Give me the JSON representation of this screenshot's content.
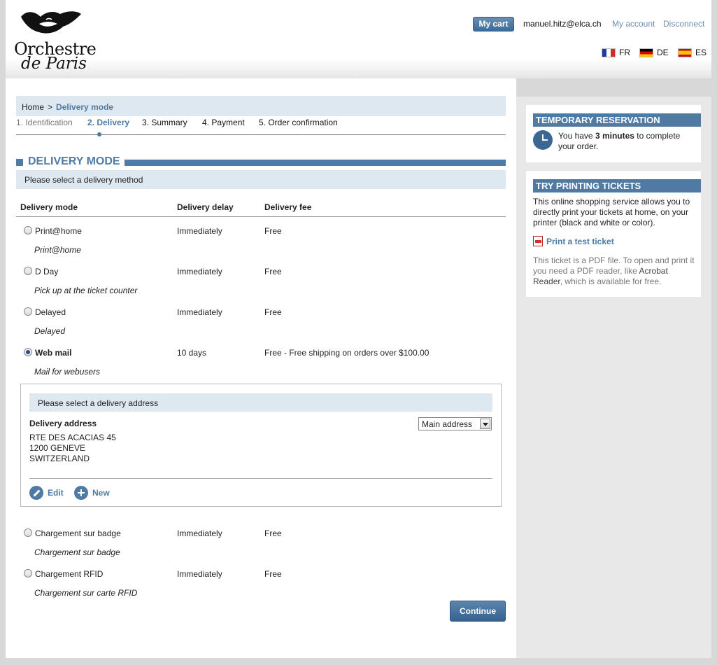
{
  "header": {
    "logo_line1": "Orchestre",
    "logo_line2": "de Paris",
    "cart_label": "My cart",
    "user_email": "manuel.hitz@elca.ch",
    "account_label": "My account",
    "disconnect_label": "Disconnect",
    "languages": [
      {
        "code": "FR",
        "flag": "flag-fr-icon"
      },
      {
        "code": "DE",
        "flag": "flag-de-icon"
      },
      {
        "code": "ES",
        "flag": "flag-es-icon"
      }
    ]
  },
  "breadcrumb": {
    "home": "Home",
    "separator": ">",
    "current": "Delivery mode"
  },
  "steps": [
    "1. Identification",
    "2. Delivery",
    "3. Summary",
    "4. Payment",
    "5. Order confirmation"
  ],
  "section_title": "DELIVERY MODE",
  "select_method": "Please select a delivery method",
  "table": {
    "headers": [
      "Delivery mode",
      "Delivery delay",
      "Delivery fee"
    ],
    "rows": [
      {
        "name": "Print@home",
        "delay": "Immediately",
        "fee": "Free",
        "desc": "Print@home",
        "selected": false
      },
      {
        "name": "D Day",
        "delay": "Immediately",
        "fee": "Free",
        "desc": "Pick up at the ticket counter",
        "selected": false
      },
      {
        "name": "Delayed",
        "delay": "Immediately",
        "fee": "Free",
        "desc": "Delayed",
        "selected": false
      },
      {
        "name": "Web mail",
        "delay": "10 days",
        "fee": "Free - Free shipping on orders over $100.00",
        "desc": "Mail for webusers",
        "selected": true
      },
      {
        "name": "Chargement sur badge",
        "delay": "Immediately",
        "fee": "Free",
        "desc": "Chargement sur badge",
        "selected": false
      },
      {
        "name": "Chargement RFID",
        "delay": "Immediately",
        "fee": "Free",
        "desc": "Chargement sur carte RFID",
        "selected": false
      }
    ]
  },
  "address": {
    "heading": "Please select a delivery address",
    "label": "Delivery address",
    "lines": [
      "RTE DES ACACIAS 45",
      "1200 GENEVE",
      "SWITZERLAND"
    ],
    "select_value": "Main address",
    "edit_label": "Edit",
    "new_label": "New"
  },
  "continue_label": "Continue",
  "sidebar": {
    "reservation_title": "TEMPORARY RESERVATION",
    "reservation_pre": "You have ",
    "reservation_bold": "3 minutes",
    "reservation_post": " to complete your order.",
    "print_title": "TRY PRINTING TICKETS",
    "print_text": "This online shopping service allows you to directly print your tickets at home, on your printer (black and white or color).",
    "print_link": "Print a test ticket",
    "pdf_pre": "This ticket is a PDF file. To open and print it you need a PDF reader, like ",
    "pdf_link": "Acrobat Reader",
    "pdf_post": ", which is available for free."
  },
  "colors": {
    "accent": "#4f7aa3",
    "light_band": "#dde8f1",
    "sidebar_bg": "#e8e8e8"
  }
}
